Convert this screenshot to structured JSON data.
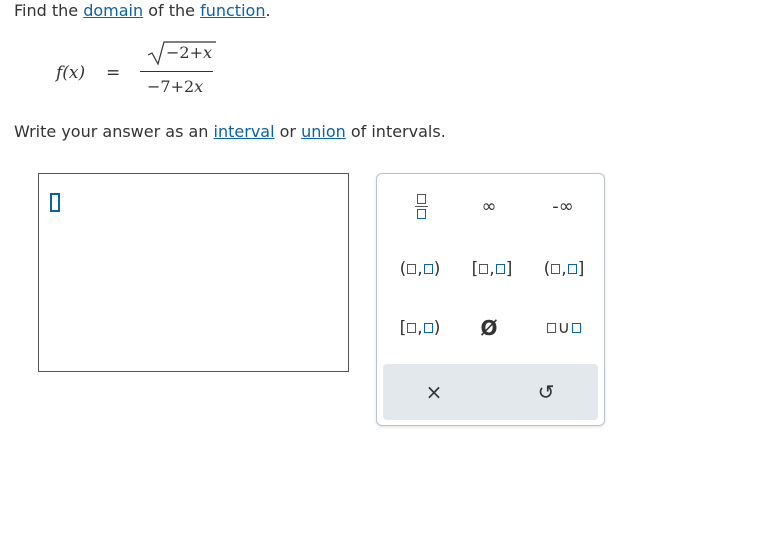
{
  "question": {
    "prefix": "Find the",
    "link_domain": "domain",
    "middle": "of the",
    "link_function": "function",
    "suffix": "."
  },
  "formula": {
    "lhs": "f(x)",
    "equals": "=",
    "numerator": "−2+",
    "numerator_var": "x",
    "denominator": "−7+2",
    "denominator_var": "x"
  },
  "instructions": {
    "prefix": "Write your answer as an",
    "link_interval": "interval",
    "middle": "or",
    "link_union": "union",
    "suffix": "of intervals."
  },
  "keypad": {
    "infinity": "∞",
    "neg_infinity": "-∞",
    "open_left": "(",
    "close_right": ")",
    "closed_left": "[",
    "closed_right": "]",
    "comma": ",",
    "empty_set": "Ø",
    "union": "∪",
    "clear": "×",
    "undo": "↺",
    "icons": [
      "fraction-icon",
      "infinity-icon",
      "negative-infinity-icon",
      "open-interval-icon",
      "closed-interval-icon",
      "left-open-interval-icon",
      "right-open-interval-icon",
      "empty-set-icon",
      "union-icon",
      "clear-icon",
      "undo-icon"
    ]
  },
  "colors": {
    "link": "#0b63a6",
    "keypad_border": "#b8c4cc",
    "bottom_bar": "#e2e8ec"
  }
}
